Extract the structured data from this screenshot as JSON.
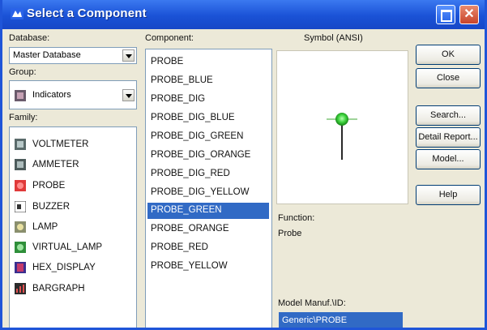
{
  "window": {
    "title": "Select a Component"
  },
  "labels": {
    "database": "Database:",
    "group": "Group:",
    "family": "Family:",
    "component": "Component:",
    "symbol": "Symbol (ANSI)",
    "function_label": "Function:",
    "function_value": "Probe",
    "model_manuf_label": "Model Manuf.\\ID:"
  },
  "database": {
    "value": "Master Database"
  },
  "group": {
    "value": "Indicators",
    "icon": "indicators-icon"
  },
  "family": [
    {
      "label": "VOLTMETER",
      "icon": "voltmeter-icon"
    },
    {
      "label": "AMMETER",
      "icon": "ammeter-icon"
    },
    {
      "label": "PROBE",
      "icon": "probe-icon"
    },
    {
      "label": "BUZZER",
      "icon": "buzzer-icon"
    },
    {
      "label": "LAMP",
      "icon": "lamp-icon"
    },
    {
      "label": "VIRTUAL_LAMP",
      "icon": "virtual-lamp-icon"
    },
    {
      "label": "HEX_DISPLAY",
      "icon": "hex-display-icon"
    },
    {
      "label": "BARGRAPH",
      "icon": "bargraph-icon"
    }
  ],
  "components": {
    "items": [
      "PROBE",
      "PROBE_BLUE",
      "PROBE_DIG",
      "PROBE_DIG_BLUE",
      "PROBE_DIG_GREEN",
      "PROBE_DIG_ORANGE",
      "PROBE_DIG_RED",
      "PROBE_DIG_YELLOW",
      "PROBE_GREEN",
      "PROBE_ORANGE",
      "PROBE_RED",
      "PROBE_YELLOW"
    ],
    "selected": "PROBE_GREEN"
  },
  "model_manuf_id": {
    "selected": "Generic\\PROBE"
  },
  "buttons": {
    "ok": "OK",
    "close": "Close",
    "search": "Search...",
    "detail_report": "Detail Report...",
    "model": "Model...",
    "help": "Help"
  },
  "colors": {
    "titlebar": "#1f55d8",
    "selection": "#316ac5",
    "probe_led": "#3cd23c"
  }
}
